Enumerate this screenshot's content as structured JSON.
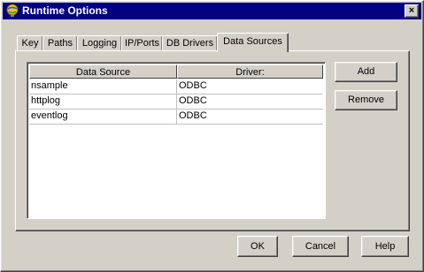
{
  "window": {
    "title": "Runtime Options",
    "close_label": "×"
  },
  "tabs": [
    {
      "label": "Key"
    },
    {
      "label": "Paths"
    },
    {
      "label": "Logging"
    },
    {
      "label": "IP/Ports"
    },
    {
      "label": "DB Drivers"
    },
    {
      "label": "Data Sources",
      "active": true
    }
  ],
  "table": {
    "columns": [
      "Data Source",
      "Driver:"
    ],
    "rows": [
      [
        "nsample",
        "ODBC"
      ],
      [
        "httplog",
        "ODBC"
      ],
      [
        "eventlog",
        "ODBC"
      ]
    ]
  },
  "side_buttons": {
    "add": "Add",
    "remove": "Remove"
  },
  "footer_buttons": {
    "ok": "OK",
    "cancel": "Cancel",
    "help": "Help"
  }
}
